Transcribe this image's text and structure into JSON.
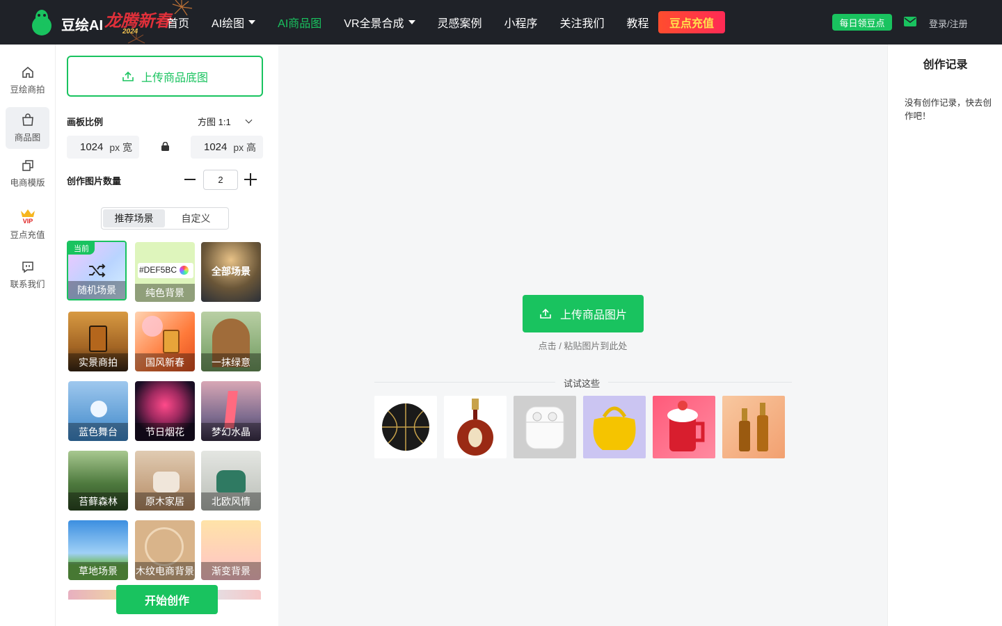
{
  "header": {
    "brand": "豆绘AI",
    "festival_text": "龙腾新春",
    "festival_year": "2024",
    "nav": [
      {
        "label": "首页",
        "has_caret": false,
        "active": false
      },
      {
        "label": "AI绘图",
        "has_caret": true,
        "active": false
      },
      {
        "label": "AI商品图",
        "has_caret": false,
        "active": true
      },
      {
        "label": "VR全景合成",
        "has_caret": true,
        "active": false
      },
      {
        "label": "灵感案例",
        "has_caret": false,
        "active": false
      },
      {
        "label": "小程序",
        "has_caret": false,
        "active": false
      },
      {
        "label": "关注我们",
        "has_caret": false,
        "active": false
      },
      {
        "label": "教程",
        "has_caret": false,
        "active": false
      }
    ],
    "recharge_label": "豆点充值",
    "daily_label": "每日领豆点",
    "login_label": "登录/注册"
  },
  "rail": {
    "items": [
      {
        "label": "豆绘商拍",
        "icon": "home-icon"
      },
      {
        "label": "商品图",
        "icon": "shopping-bag-icon"
      },
      {
        "label": "电商模版",
        "icon": "template-icon"
      },
      {
        "label": "豆点充值",
        "icon": "vip-crown-icon",
        "vip_text": "VIP"
      },
      {
        "label": "联系我们",
        "icon": "chat-icon"
      }
    ]
  },
  "panel": {
    "upload_base_label": "上传商品底图",
    "ratio_label": "画板比例",
    "ratio_value": "方图 1:1",
    "width_value": "1024",
    "width_unit": "px 宽",
    "height_value": "1024",
    "height_unit": "px 高",
    "count_label": "创作图片数量",
    "count_value": "2",
    "tabs": [
      "推荐场景",
      "自定义"
    ],
    "current_tag": "当前",
    "hex_value": "#DEF5BC",
    "scenes": [
      "随机场景",
      "纯色背景",
      "全部场景",
      "实景商拍",
      "国风新春",
      "一抹绿意",
      "蓝色舞台",
      "节日烟花",
      "梦幻水晶",
      "苔藓森林",
      "原木家居",
      "北欧风情",
      "草地场景",
      "木纹电商背景",
      "渐变背景"
    ],
    "start_label": "开始创作"
  },
  "canvas": {
    "upload_label": "上传商品图片",
    "hint": "点击 / 粘贴图片到此处",
    "try_label": "试试这些",
    "samples": [
      "basketball",
      "cognac-bottle",
      "earbuds-case",
      "yellow-bag",
      "red-mug",
      "serum-bottles"
    ]
  },
  "history": {
    "title": "创作记录",
    "empty_text": "没有创作记录，快去创作吧！"
  },
  "colors": {
    "accent": "#19c35f",
    "topbar": "#1f2228",
    "recharge_text": "#ffe14d"
  }
}
